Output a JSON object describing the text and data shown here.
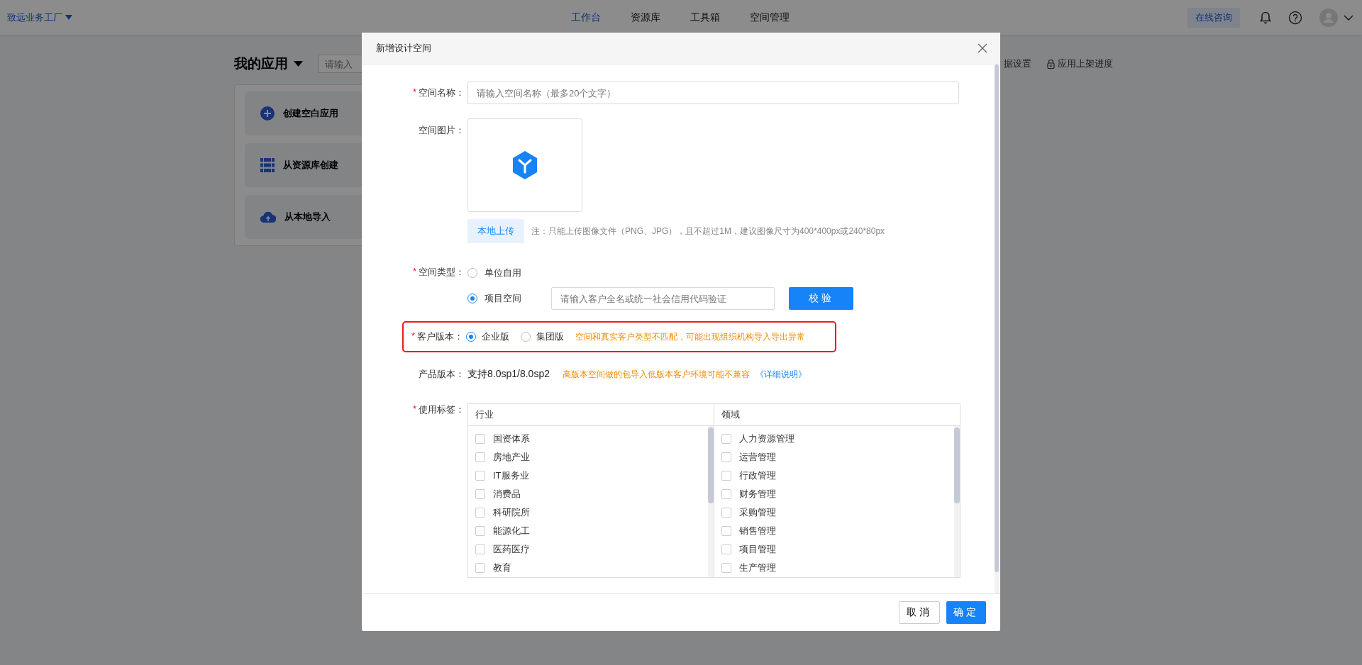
{
  "top_bar": {
    "workspace": "致远业务工厂",
    "nav": [
      {
        "label": "工作台",
        "selected": true
      },
      {
        "label": "资源库",
        "selected": false
      },
      {
        "label": "工具箱",
        "selected": false
      },
      {
        "label": "空间管理",
        "selected": false
      }
    ],
    "consult_button": "在线咨询"
  },
  "page": {
    "title": "我的应用",
    "search_placeholder": "请输入",
    "create_options": [
      {
        "kind": "plus",
        "label": "创建空白应用"
      },
      {
        "kind": "grid",
        "label": "从资源库创建"
      },
      {
        "kind": "cloud",
        "label": "从本地导入"
      }
    ],
    "toolbar_links": [
      {
        "kind": "plain",
        "label": "据设置"
      },
      {
        "kind": "lock",
        "label": "应用上架进度"
      }
    ]
  },
  "dialog": {
    "title": "新增设计空间",
    "name": {
      "label": "空间名称：",
      "required_mark": "*",
      "placeholder": "请输入空间名称（最多20个文字）"
    },
    "image": {
      "label": "空间图片：",
      "upload_button": "本地上传",
      "hint": "注：只能上传图像文件（PNG、JPG），且不超过1M，建议图像尺寸为400*400px或240*80px"
    },
    "space_type": {
      "label": "空间类型：",
      "required_mark": "*",
      "options": [
        {
          "label": "单位自用",
          "selected": false
        },
        {
          "label": "项目空间",
          "selected": true
        }
      ],
      "verify_placeholder": "请输入客户全名或统一社会信用代码验证",
      "verify_button": "校验"
    },
    "edition": {
      "label": "客户版本：",
      "required_mark": "*",
      "highlighted": true,
      "options": [
        {
          "label": "企业版",
          "selected": true
        },
        {
          "label": "集团版",
          "selected": false
        }
      ],
      "warning": "空间和真实客户类型不匹配，可能出现组织机构导入导出异常"
    },
    "product_version": {
      "label": "产品版本：",
      "value": "支持8.0sp1/8.0sp2",
      "note": "高版本空间做的包导入低版本客户环境可能不兼容",
      "link": "《详细说明》"
    },
    "tags": {
      "label": "使用标签：",
      "required_mark": "*",
      "columns": [
        {
          "heading": "行业",
          "items": [
            {
              "label": "国资体系",
              "checked": false
            },
            {
              "label": "房地产业",
              "checked": false
            },
            {
              "label": "IT服务业",
              "checked": false
            },
            {
              "label": "消费品",
              "checked": false
            },
            {
              "label": "科研院所",
              "checked": false
            },
            {
              "label": "能源化工",
              "checked": false
            },
            {
              "label": "医药医疗",
              "checked": false
            },
            {
              "label": "教育",
              "checked": false
            }
          ]
        },
        {
          "heading": "领域",
          "items": [
            {
              "label": "人力资源管理",
              "checked": false
            },
            {
              "label": "运营管理",
              "checked": false
            },
            {
              "label": "行政管理",
              "checked": false
            },
            {
              "label": "财务管理",
              "checked": false
            },
            {
              "label": "采购管理",
              "checked": false
            },
            {
              "label": "销售管理",
              "checked": false
            },
            {
              "label": "项目管理",
              "checked": false
            },
            {
              "label": "生产管理",
              "checked": false
            }
          ]
        }
      ]
    },
    "buttons": {
      "cancel": "取消",
      "confirm": "确定"
    }
  }
}
